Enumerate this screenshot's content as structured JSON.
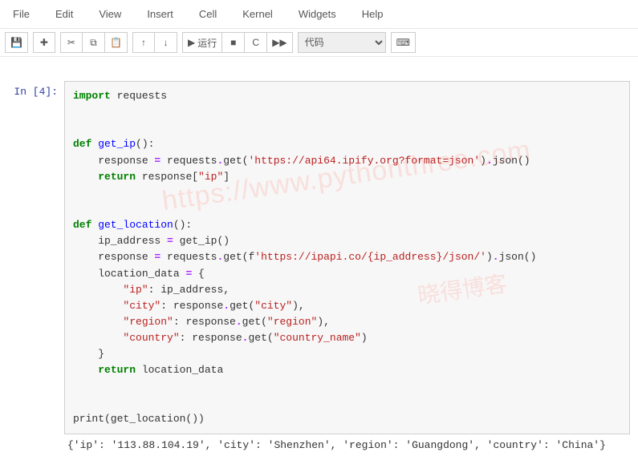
{
  "menubar": {
    "items": [
      "File",
      "Edit",
      "View",
      "Insert",
      "Cell",
      "Kernel",
      "Widgets",
      "Help"
    ]
  },
  "toolbar": {
    "save_icon": "💾",
    "add_icon": "✚",
    "cut_icon": "✂",
    "copy_icon": "⧉",
    "paste_icon": "📋",
    "up_icon": "↑",
    "down_icon": "↓",
    "run_icon": "▶",
    "run_label": "运行",
    "stop_icon": "■",
    "restart_icon": "C",
    "ff_icon": "▶▶",
    "keyboard_icon": "⌨",
    "celltype_selected": "代码"
  },
  "cell": {
    "prompt_label": "In  [4]:",
    "output_text": "{'ip': '113.88.104.19', 'city': 'Shenzhen', 'region': 'Guangdong', 'country': 'China'}"
  },
  "code": {
    "l1_kw": "import",
    "l1_mod": " requests",
    "l3_kw": "def",
    "l3_fn": " get_ip",
    "l3_rest": "():",
    "l4a": "    response ",
    "l4_op": "=",
    "l4b": " requests",
    "l4_dot": ".",
    "l4c": "get(",
    "l4_str": "'https://api64.ipify.org?format=json'",
    "l4d": ")",
    "l4_dot2": ".",
    "l4e": "json()",
    "l5_kw": "return",
    "l5a": " response[",
    "l5_str": "\"ip\"",
    "l5b": "]",
    "l7_kw": "def",
    "l7_fn": " get_location",
    "l7_rest": "():",
    "l8a": "    ip_address ",
    "l8_op": "=",
    "l8b": " get_ip()",
    "l9a": "    response ",
    "l9_op": "=",
    "l9b": " requests",
    "l9_dot": ".",
    "l9c": "get(",
    "l9_f": "f",
    "l9_str": "'https://ipapi.co/{ip_address}/json/'",
    "l9d": ")",
    "l9_dot2": ".",
    "l9e": "json()",
    "l10a": "    location_data ",
    "l10_op": "=",
    "l10b": " {",
    "l11a": "        ",
    "l11_str": "\"ip\"",
    "l11b": ": ip_address,",
    "l12a": "        ",
    "l12_str": "\"city\"",
    "l12b": ": response",
    "l12_dot": ".",
    "l12c": "get(",
    "l12_str2": "\"city\"",
    "l12d": "),",
    "l13a": "        ",
    "l13_str": "\"region\"",
    "l13b": ": response",
    "l13_dot": ".",
    "l13c": "get(",
    "l13_str2": "\"region\"",
    "l13d": "),",
    "l14a": "        ",
    "l14_str": "\"country\"",
    "l14b": ": response",
    "l14_dot": ".",
    "l14c": "get(",
    "l14_str2": "\"country_name\"",
    "l14d": ")",
    "l15": "    }",
    "l16_kw": "return",
    "l16a": " location_data",
    "l18a": "print(get_location())"
  },
  "watermark": {
    "line1": "https://www.pythonthree.com",
    "line2": "晓得博客"
  }
}
